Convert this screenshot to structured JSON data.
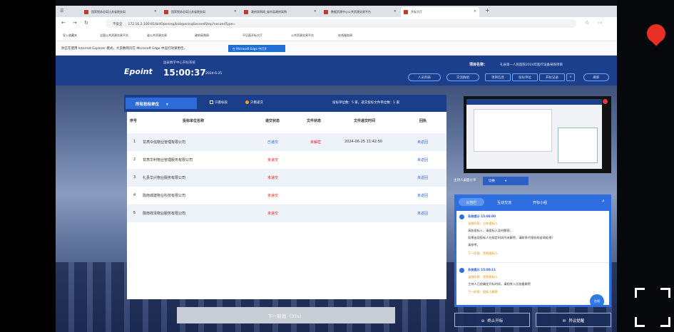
{
  "browser": {
    "tabs": [
      "国家税务总局江苏省税务局",
      "国家税务总局江苏省税务局",
      "政府采购网_省市县政府采购",
      "数据资源中心公共资源交易平台",
      "开标大厅"
    ],
    "address": "172.16.2.100:81/bidOpening/bidopeningSecondStep?secondType=",
    "not_secure": "不安全",
    "bookmarks": [
      "导入收藏夹",
      "全国公共资源交易平台",
      "省公共资源交易",
      "政府采购网",
      "不见面开标大厅",
      "公共资源交易平台",
      "在线服务网"
    ],
    "ie_notice": "你正在使用 Internet Explorer 模式。大多数网页在 Microsoft Edge 中运行效果更佳。",
    "ie_button": "在 Microsoft Edge 中打开"
  },
  "header": {
    "logo": "Epoint",
    "center_name": "国泰数字中心开标系统",
    "time": "15:00:37",
    "date": "2024-6-25",
    "project_label": "项目名称：",
    "project_name": "礼县第一人民医院2024年医疗设备采购项目",
    "buttons": [
      "人员列表",
      "交流群组",
      "项目信息",
      "投标单位",
      "开标记录",
      "刷新"
    ]
  },
  "panel": {
    "unit_dropdown": "所有投标单位",
    "show_all": "只看标段",
    "show_received": "只看递交",
    "count_text": "投标单位数：5 家，递交投标文件单位数：1 家",
    "columns": [
      "序号",
      "投标单位名称",
      "递交状态",
      "文件状态",
      "文件递交时间",
      "回执"
    ],
    "rows": [
      {
        "no": "1",
        "name": "甘肃众信物业管理有限公司",
        "submit": "已递交",
        "file": "未解密",
        "time": "2024-06-25 11:42:50",
        "receipt": "未返回"
      },
      {
        "no": "2",
        "name": "甘肃华利物业管理服务有限公司",
        "submit": "未递交",
        "file": "",
        "time": "",
        "receipt": "未返回"
      },
      {
        "no": "3",
        "name": "礼县华兴物业服务有限公司",
        "submit": "未递交",
        "file": "",
        "time": "",
        "receipt": "未返回"
      },
      {
        "no": "4",
        "name": "陇南城建物业科技有限公司",
        "submit": "未递交",
        "file": "",
        "time": "",
        "receipt": "未返回"
      },
      {
        "no": "5",
        "name": "陇南祥泽物业服务有限公司",
        "submit": "未递交",
        "file": "",
        "time": "",
        "receipt": "未返回"
      }
    ],
    "next_button": "下一阶段（31s）"
  },
  "video": {
    "select_label": "主持人桌面分享",
    "select_value": "切换"
  },
  "chat": {
    "tabs": [
      "公告栏",
      "互动交流",
      "开标小组"
    ],
    "messages": [
      {
        "sender": "系统提示 15:00:00",
        "lines": [
          "当前阶段：公布投标人",
          "请各投标人，请投标人及时解密。",
          "如果出现投标人在规定时间内未解密，请联系代理机构咨询处理？",
          "请参考。",
          "下一阶段：签到投标人"
        ]
      },
      {
        "sender": "系统提示 15:00:11",
        "lines": [
          "当前阶段：签到投标人",
          "主持人已经确定开标时间，请相关人员准备解密",
          "下一阶段：投标人解密"
        ]
      }
    ],
    "fab": "在线"
  },
  "bottom_buttons": [
    "终止开标",
    "异议提醒"
  ]
}
